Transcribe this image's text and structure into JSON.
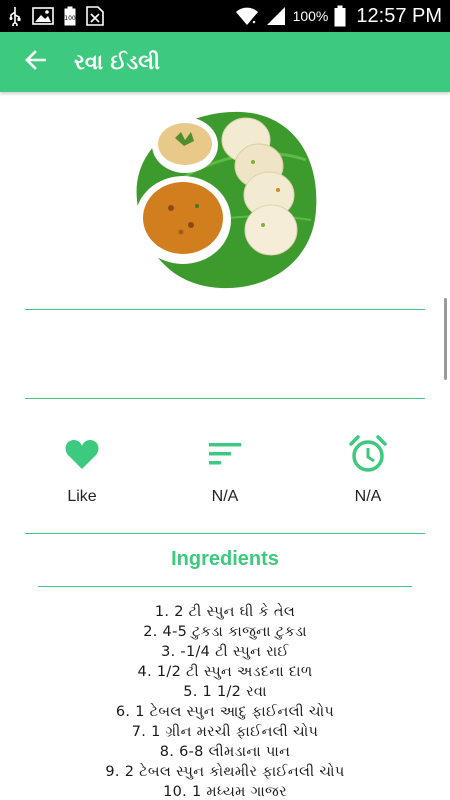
{
  "status_bar": {
    "battery_percent": "100%",
    "time": "12:57 PM"
  },
  "app_bar": {
    "title": "રવા ઈડલી",
    "back_icon": "arrow-left-icon"
  },
  "colors": {
    "accent": "#3dc97e",
    "text": "#1a1a1a"
  },
  "stats": [
    {
      "icon": "heart-icon",
      "label": "Like"
    },
    {
      "icon": "sort-lines-icon",
      "label": "N/A"
    },
    {
      "icon": "alarm-clock-icon",
      "label": "N/A"
    }
  ],
  "ingredients": {
    "title": "Ingredients",
    "items": [
      "1. 2 ટી સ્પુન ઘી કે તેલ",
      "2. 4-5 ટુકડા કાજુના ટુકડા",
      "3. -1/4 ટી સ્પુન રાઈ",
      "4. 1/2 ટી સ્પુન અડદના દાળ",
      "5. 1 1/2 રવા",
      "6. 1 ટેબલ સ્પુન આદુ ફાઈનલી ચોપ",
      "7. 1 ગ્રીન મરચી ફાઈનલી ચોપ",
      "8. 6-8 લીમડાના પાન",
      "9. 2 ટેબલ સ્પુન કોથમીર ફાઈનલી ચોપ",
      "10. 1 મધ્યમ ગાજર"
    ]
  }
}
